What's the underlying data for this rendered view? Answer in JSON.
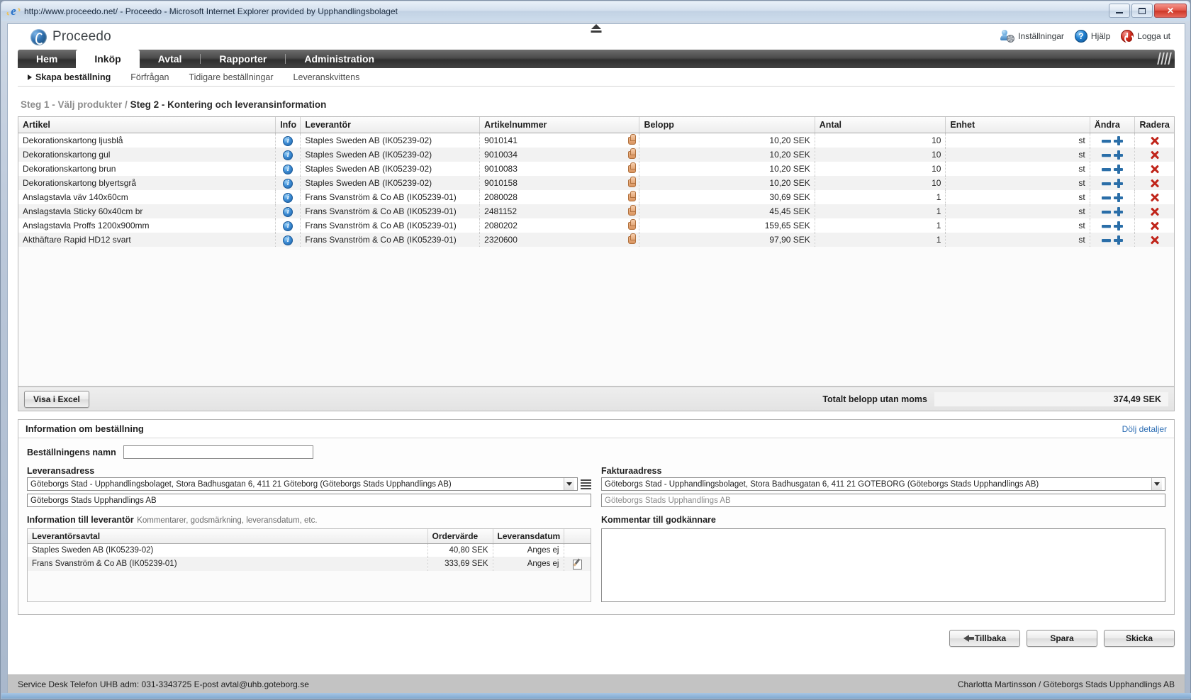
{
  "window": {
    "title": "http://www.proceedo.net/ - Proceedo - Microsoft Internet Explorer provided by Upphandlingsbolaget",
    "minimize": "–",
    "maximize": "□",
    "close": "✕"
  },
  "header": {
    "brand": "Proceedo",
    "tools": [
      {
        "label": "Inställningar",
        "icon": "settings-icon"
      },
      {
        "label": "Hjälp",
        "icon": "help-icon"
      },
      {
        "label": "Logga ut",
        "icon": "power-icon"
      }
    ]
  },
  "nav": {
    "tabs": [
      {
        "label": "Hem",
        "active": false
      },
      {
        "label": "Inköp",
        "active": true
      },
      {
        "label": "Avtal",
        "active": false
      },
      {
        "label": "Rapporter",
        "active": false
      },
      {
        "label": "Administration",
        "active": false
      }
    ],
    "subnav": [
      {
        "label": "Skapa beställning",
        "active": true
      },
      {
        "label": "Förfrågan",
        "active": false
      },
      {
        "label": "Tidigare beställningar",
        "active": false
      },
      {
        "label": "Leveranskvittens",
        "active": false
      }
    ]
  },
  "breadcrumb": {
    "step1": "Steg 1 - Välj produkter",
    "separator": "/",
    "step2": "Steg 2 - Kontering och leveransinformation"
  },
  "items_table": {
    "columns": [
      "Artikel",
      "Info",
      "Leverantör",
      "Artikelnummer",
      "Belopp",
      "Antal",
      "Enhet",
      "Ändra",
      "Radera"
    ],
    "rows": [
      {
        "artikel": "Dekorationskartong ljusblå",
        "leaf": true,
        "leverantor": "Staples Sweden AB (IK05239-02)",
        "artikelnummer": "9010141",
        "belopp": "10,20 SEK",
        "antal": "10",
        "enhet": "st"
      },
      {
        "artikel": "Dekorationskartong gul",
        "leaf": true,
        "leverantor": "Staples Sweden AB (IK05239-02)",
        "artikelnummer": "9010034",
        "belopp": "10,20 SEK",
        "antal": "10",
        "enhet": "st"
      },
      {
        "artikel": "Dekorationskartong brun",
        "leaf": true,
        "leverantor": "Staples Sweden AB (IK05239-02)",
        "artikelnummer": "9010083",
        "belopp": "10,20 SEK",
        "antal": "10",
        "enhet": "st"
      },
      {
        "artikel": "Dekorationskartong blyertsgrå",
        "leaf": true,
        "leverantor": "Staples Sweden AB (IK05239-02)",
        "artikelnummer": "9010158",
        "belopp": "10,20 SEK",
        "antal": "10",
        "enhet": "st"
      },
      {
        "artikel": "Anslagstavla väv     140x60cm",
        "leaf": false,
        "leverantor": "Frans Svanström & Co AB (IK05239-01)",
        "artikelnummer": "2080028",
        "belopp": "30,69 SEK",
        "antal": "1",
        "enhet": "st"
      },
      {
        "artikel": "Anslagstavla Sticky 60x40cm br",
        "leaf": false,
        "leverantor": "Frans Svanström & Co AB (IK05239-01)",
        "artikelnummer": "2481152",
        "belopp": "45,45 SEK",
        "antal": "1",
        "enhet": "st"
      },
      {
        "artikel": "Anslagstavla Proffs 1200x900mm",
        "leaf": false,
        "leverantor": "Frans Svanström & Co AB (IK05239-01)",
        "artikelnummer": "2080202",
        "belopp": "159,65 SEK",
        "antal": "1",
        "enhet": "st"
      },
      {
        "artikel": "Akthäftare Rapid HD12   svart",
        "leaf": false,
        "leverantor": "Frans Svanström & Co AB (IK05239-01)",
        "artikelnummer": "2320600",
        "belopp": "97,90 SEK",
        "antal": "1",
        "enhet": "st"
      }
    ],
    "excel_button": "Visa i Excel",
    "total_label": "Totalt belopp utan moms",
    "total_value": "374,49 SEK"
  },
  "order_info": {
    "title": "Information om beställning",
    "hide_details_link": "Dölj detaljer",
    "order_name_label": "Beställningens namn",
    "order_name_value": "",
    "delivery_address_label": "Leveransadress",
    "delivery_address_value": "Göteborgs Stad - Upphandlingsbolaget, Stora Badhusgatan 6, 411 21 Göteborg (Göteborgs Stads Upphandlings AB)",
    "delivery_address_line2": "Göteborgs Stads Upphandlings AB",
    "invoice_address_label": "Fakturaadress",
    "invoice_address_value": "Göteborgs Stad - Upphandlingsbolaget, Stora Badhusgatan 6, 411 21 GÖTEBORG (Göteborgs Stads Upphandlings AB)",
    "invoice_address_line2": "Göteborgs Stads Upphandlings AB",
    "supplier_info_label": "Information till leverantör",
    "supplier_info_hint": "Kommentarer, godsmärkning, leveransdatum, etc.",
    "approver_comment_label": "Kommentar till godkännare",
    "approver_comment_value": "",
    "supplier_table": {
      "columns": [
        "Leverantörsavtal",
        "Ordervärde",
        "Leveransdatum",
        ""
      ],
      "rows": [
        {
          "avtal": "Staples Sweden AB (IK05239-02)",
          "ordervarde": "40,80 SEK",
          "leveransdatum": "Anges ej",
          "has_edit": false
        },
        {
          "avtal": "Frans Svanström & Co AB (IK05239-01)",
          "ordervarde": "333,69 SEK",
          "leveransdatum": "Anges ej",
          "has_edit": true
        }
      ]
    }
  },
  "actions": {
    "back": "Tillbaka",
    "save": "Spara",
    "send": "Skicka"
  },
  "statusbar": {
    "left": "Service Desk Telefon UHB adm: 031-3343725   E-post avtal@uhb.goteborg.se",
    "right": "Charlotta Martinsson / Göteborgs Stads Upphandlings AB"
  }
}
